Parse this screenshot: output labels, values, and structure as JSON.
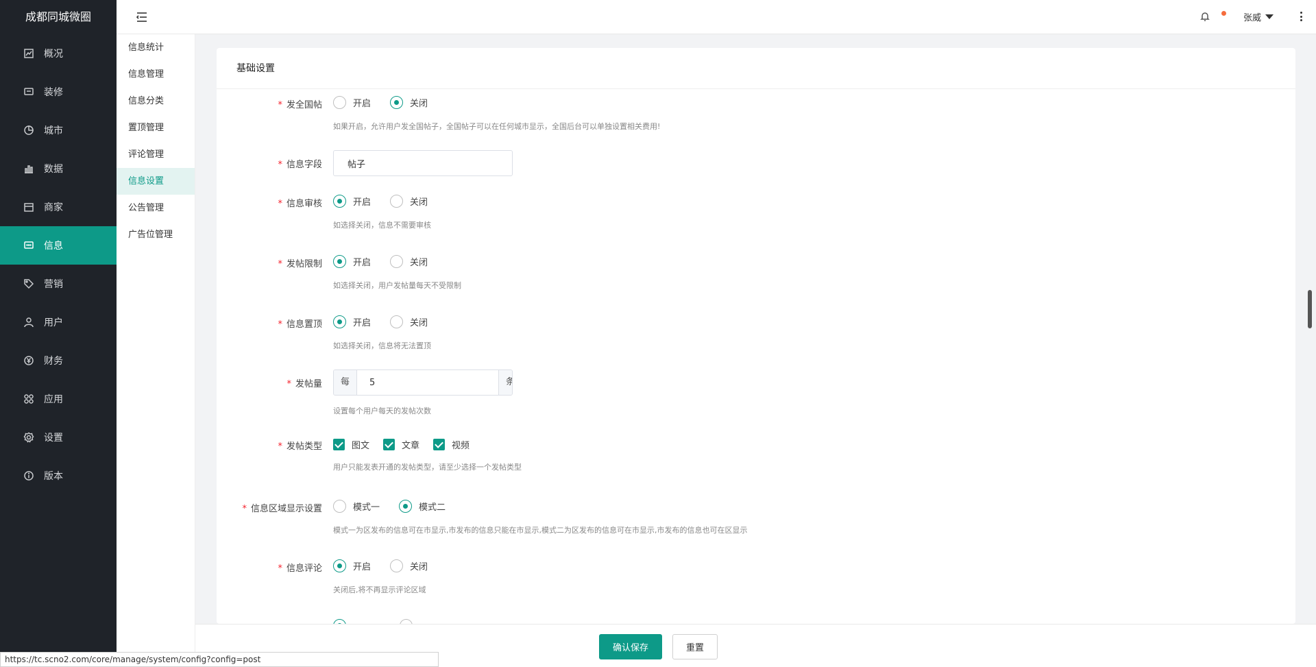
{
  "brand": "成都同城微圈",
  "nav": [
    {
      "label": "概况",
      "icon": "dashboard-icon",
      "active": false
    },
    {
      "label": "装修",
      "icon": "decorate-icon",
      "active": false
    },
    {
      "label": "城市",
      "icon": "city-icon",
      "active": false
    },
    {
      "label": "数据",
      "icon": "bar-chart-icon",
      "active": false
    },
    {
      "label": "商家",
      "icon": "store-icon",
      "active": false
    },
    {
      "label": "信息",
      "icon": "message-icon",
      "active": true
    },
    {
      "label": "营销",
      "icon": "tag-icon",
      "active": false
    },
    {
      "label": "用户",
      "icon": "user-icon",
      "active": false
    },
    {
      "label": "财务",
      "icon": "yen-icon",
      "active": false
    },
    {
      "label": "应用",
      "icon": "apps-icon",
      "active": false
    },
    {
      "label": "设置",
      "icon": "gear-icon",
      "active": false
    },
    {
      "label": "版本",
      "icon": "info-icon",
      "active": false
    }
  ],
  "submenu": [
    {
      "label": "信息统计",
      "active": false
    },
    {
      "label": "信息管理",
      "active": false
    },
    {
      "label": "信息分类",
      "active": false
    },
    {
      "label": "置顶管理",
      "active": false
    },
    {
      "label": "评论管理",
      "active": false
    },
    {
      "label": "信息设置",
      "active": true
    },
    {
      "label": "公告管理",
      "active": false
    },
    {
      "label": "广告位管理",
      "active": false
    }
  ],
  "header": {
    "user_name": "张威"
  },
  "panel": {
    "title": "基础设置"
  },
  "form": {
    "national_post": {
      "label": "发全国帖",
      "on": "开启",
      "off": "关闭",
      "hint": "如果开启，允许用户发全国帖子，全国帖子可以在任何城市显示，全国后台可以单独设置相关费用!"
    },
    "info_field": {
      "label": "信息字段",
      "value": "帖子"
    },
    "info_review": {
      "label": "信息审核",
      "on": "开启",
      "off": "关闭",
      "hint": "如选择关闭，信息不需要审核"
    },
    "post_limit": {
      "label": "发帖限制",
      "on": "开启",
      "off": "关闭",
      "hint": "如选择关闭，用户发帖量每天不受限制"
    },
    "info_top": {
      "label": "信息置顶",
      "on": "开启",
      "off": "关闭",
      "hint": "如选择关闭，信息将无法置顶"
    },
    "post_count": {
      "label": "发帖量",
      "prefix": "每天",
      "value": "5",
      "suffix": "条",
      "hint": "设置每个用户每天的发帖次数"
    },
    "post_type": {
      "label": "发帖类型",
      "options": [
        "图文",
        "文章",
        "视频"
      ],
      "hint": "用户只能发表开通的发帖类型，请至少选择一个发帖类型"
    },
    "area_display": {
      "label": "信息区域显示设置",
      "mode1": "模式一",
      "mode2": "模式二",
      "hint": "模式一为区发布的信息可在市显示,市发布的信息只能在市显示,模式二为区发布的信息可在市显示,市发布的信息也可在区显示"
    },
    "info_comment": {
      "label": "信息评论",
      "on": "开启",
      "off": "关闭",
      "hint": "关闭后,将不再显示评论区域"
    }
  },
  "footer": {
    "save": "确认保存",
    "reset": "重置"
  },
  "status_url": "https://tc.scno2.com/core/manage/system/config?config=post"
}
